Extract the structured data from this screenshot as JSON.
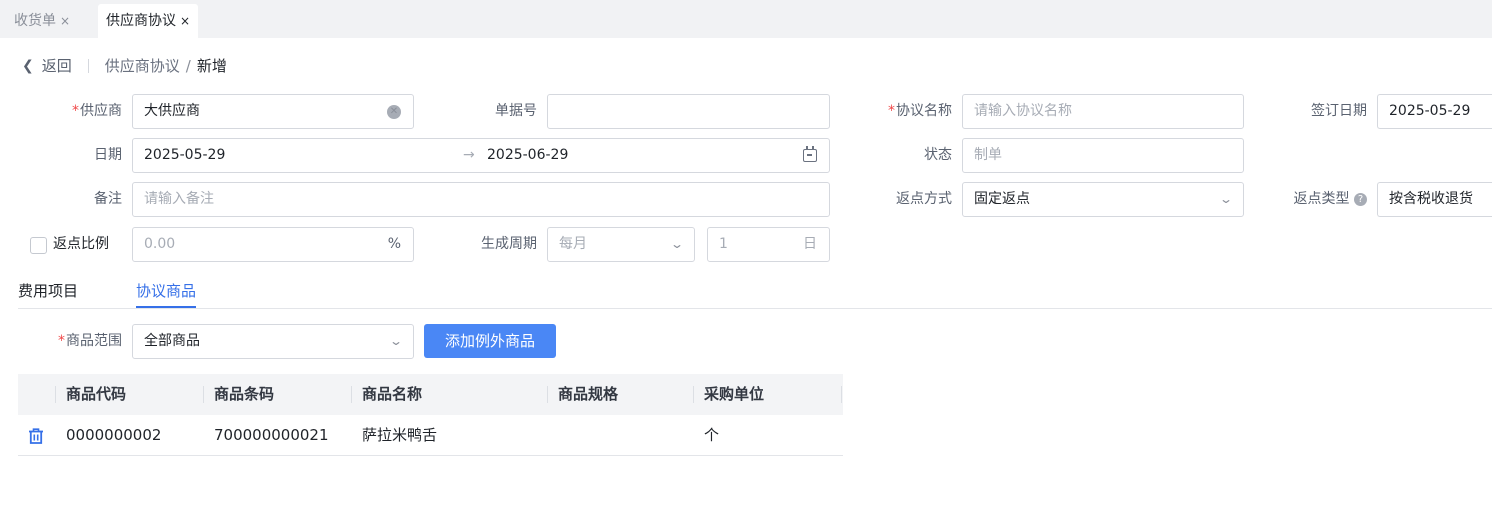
{
  "tabs": [
    {
      "label": "收货单",
      "close": "×"
    },
    {
      "label": "供应商协议",
      "close": "×"
    }
  ],
  "breadcrumb": {
    "back": "返回",
    "parent": "供应商协议",
    "separator": "/",
    "current": "新增"
  },
  "form": {
    "supplier": {
      "label": "供应商",
      "value": "大供应商"
    },
    "doc_no": {
      "label": "单据号",
      "value": ""
    },
    "agreement_name": {
      "label": "协议名称",
      "placeholder": "请输入协议名称"
    },
    "sign_date": {
      "label": "签订日期",
      "value": "2025-05-29"
    },
    "date": {
      "label": "日期",
      "start": "2025-05-29",
      "arrow": "→",
      "end": "2025-06-29"
    },
    "status": {
      "label": "状态",
      "value": "制单"
    },
    "remark": {
      "label": "备注",
      "placeholder": "请输入备注"
    },
    "rebate_method": {
      "label": "返点方式",
      "value": "固定返点"
    },
    "rebate_type": {
      "label": "返点类型",
      "value": "按含税收退货"
    },
    "rebate_ratio": {
      "label": "返点比例",
      "placeholder": "0.00",
      "unit": "%",
      "checked": false
    },
    "cycle": {
      "label": "生成周期",
      "value": "每月",
      "day_placeholder": "1",
      "day_unit": "日"
    }
  },
  "subtabs": [
    {
      "label": "费用项目",
      "active": false
    },
    {
      "label": "协议商品",
      "active": true
    }
  ],
  "goods_scope": {
    "label": "商品范围",
    "value": "全部商品",
    "add_button": "添加例外商品"
  },
  "table": {
    "columns": [
      "商品代码",
      "商品条码",
      "商品名称",
      "商品规格",
      "采购单位"
    ],
    "rows": [
      {
        "code": "0000000002",
        "barcode": "700000000021",
        "name": "萨拉米鸭舌",
        "spec": "",
        "unit": "个"
      }
    ]
  },
  "colors": {
    "accent": "#3670e8",
    "button": "#4a87f5",
    "required": "#f04848"
  }
}
